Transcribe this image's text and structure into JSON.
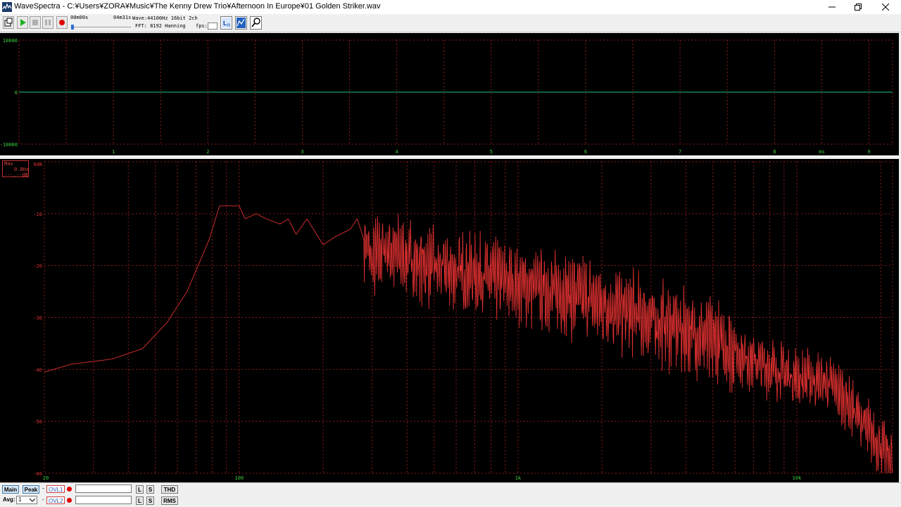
{
  "window": {
    "title": "WaveSpectra - C:¥Users¥ZORA¥Music¥The Kenny Drew Trio¥Afternoon In Europe¥01 Golden Striker.wav",
    "minimize_icon": "minimize-icon",
    "restore_icon": "restore-icon",
    "close_icon": "close-icon"
  },
  "toolbar": {
    "time_current": "00m00s",
    "time_total": "04m31s",
    "wave_info": "Wave:44100Hz 16bit 2ch",
    "fft_info": "FFT: 8192 Hanning",
    "fps_label": "fps:",
    "position_fraction": 0.0
  },
  "wave_panel": {
    "y_labels": [
      "10000",
      "0",
      "-10000"
    ],
    "x_labels": [
      "1",
      "2",
      "3",
      "4",
      "5",
      "6",
      "7",
      "8",
      "9"
    ],
    "x_unit": "ms"
  },
  "spectrum_panel": {
    "peak_box": [
      "Max",
      "0.0Hz",
      "---.--dB"
    ],
    "y_labels": [
      "0dB",
      "-10",
      "-20",
      "-30",
      "-40",
      "-50",
      "-60"
    ],
    "x_labels": [
      "20",
      "100",
      "1k",
      "10k"
    ]
  },
  "bottom": {
    "main_label": "Main",
    "peak_label": "Peak",
    "avg_label": "Avg:",
    "avg_value": "1",
    "ovl1": "OVL1",
    "ovl2": "OVL2",
    "l_label": "L",
    "s_label": "S",
    "thd_label": "THD",
    "rms_label": "RMS",
    "dash": "-"
  },
  "colors": {
    "trace": "#e03030",
    "wave_line": "#20c080",
    "grid": "#8a1a1a",
    "axis_text": "#40d040",
    "axis_text_spectrum": "#e03030"
  }
}
